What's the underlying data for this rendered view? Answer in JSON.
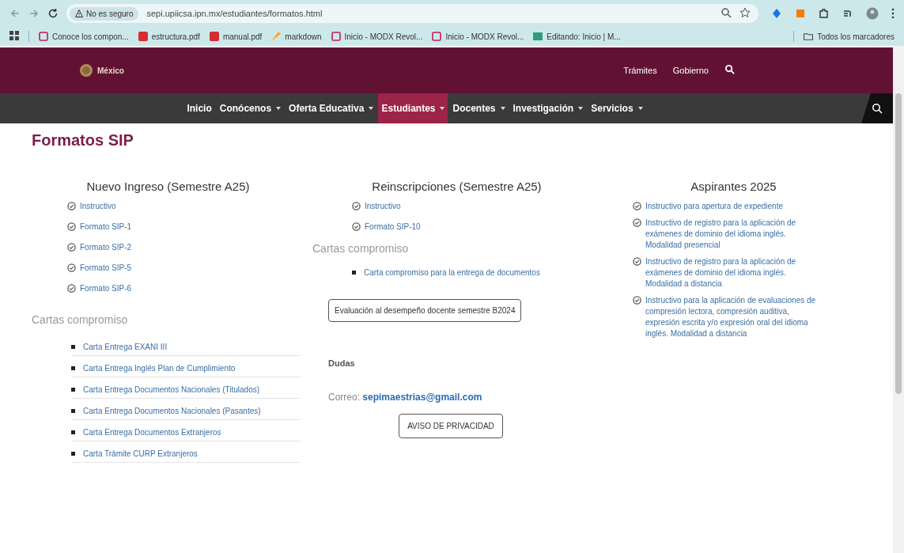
{
  "browser": {
    "security": "No es seguro",
    "url": "sepi.upiicsa.ipn.mx/estudiantes/formatos.html",
    "bookmarks": [
      {
        "label": "Conoce los compon...",
        "kind": "page"
      },
      {
        "label": "estructura.pdf",
        "kind": "pdf"
      },
      {
        "label": "manual.pdf",
        "kind": "pdf"
      },
      {
        "label": "markdown",
        "kind": "tool"
      },
      {
        "label": "Inicio - MODX Revol...",
        "kind": "page"
      },
      {
        "label": "Inicio - MODX Revol...",
        "kind": "page"
      },
      {
        "label": "Editando: Inicio | M...",
        "kind": "edit"
      }
    ],
    "all_bookmarks": "Todos los marcadores"
  },
  "header": {
    "logo_text": "México",
    "links": [
      "Trámites",
      "Gobierno"
    ]
  },
  "nav": [
    {
      "label": "Inicio",
      "dropdown": false,
      "selected": false
    },
    {
      "label": "Conócenos",
      "dropdown": true,
      "selected": false
    },
    {
      "label": "Oferta Educativa",
      "dropdown": true,
      "selected": false
    },
    {
      "label": "Estudiantes",
      "dropdown": true,
      "selected": true
    },
    {
      "label": "Docentes",
      "dropdown": true,
      "selected": false
    },
    {
      "label": "Investigación",
      "dropdown": true,
      "selected": false
    },
    {
      "label": "Servicios",
      "dropdown": true,
      "selected": false
    }
  ],
  "page_title": "Formatos SIP",
  "columns": [
    {
      "title": "Nuevo Ingreso (Semestre A25)",
      "links": [
        "Instructivo",
        "Formato SIP-1",
        "Formato SIP-2",
        "Formato SIP-5",
        "Formato SIP-6"
      ],
      "cartas_title": "Cartas compromiso",
      "cartas": [
        "Carta Entrega EXANI III",
        "Carta Entrega Inglés Plan de Cumplimiento",
        "Carta Entrega Documentos Nacionales (Titulados)",
        "Carta Entrega Documentos Nacionales (Pasantes)",
        "Carta Entrega Documentos Extranjeros",
        "Carta Trámite CURP Extranjeros"
      ]
    },
    {
      "title": "Reinscripciones (Semestre A25)",
      "links": [
        "Instructivo",
        "Formato SIP-10"
      ],
      "cartas_title": "Cartas compromiso",
      "cartas": [
        "Carta compromiso para la entrega de documentos"
      ],
      "button": "Evaluación al desempeño docente semestre B2024",
      "dudas": "Dudas",
      "correo_label": "Correo:",
      "correo": "sepimaestrias@gmail.com",
      "privacy": "AVISO DE PRIVACIDAD"
    },
    {
      "title": "Aspirantes 2025",
      "links": [
        "Instructivo para apertura de expediente",
        "Instructivo de registro para la aplicación de exámenes de dominio del idioma inglés. Modalidad presencial",
        "Instructivo de registro para la aplicación de exámenes de dominio del idioma inglés. Modalidad a distancia",
        "Instructivo para la aplicación de evaluaciones de compresión lectora, compresión auditiva, expresión escrita y/o expresión oral del idioma inglés. Modalidad a distancia"
      ]
    }
  ]
}
